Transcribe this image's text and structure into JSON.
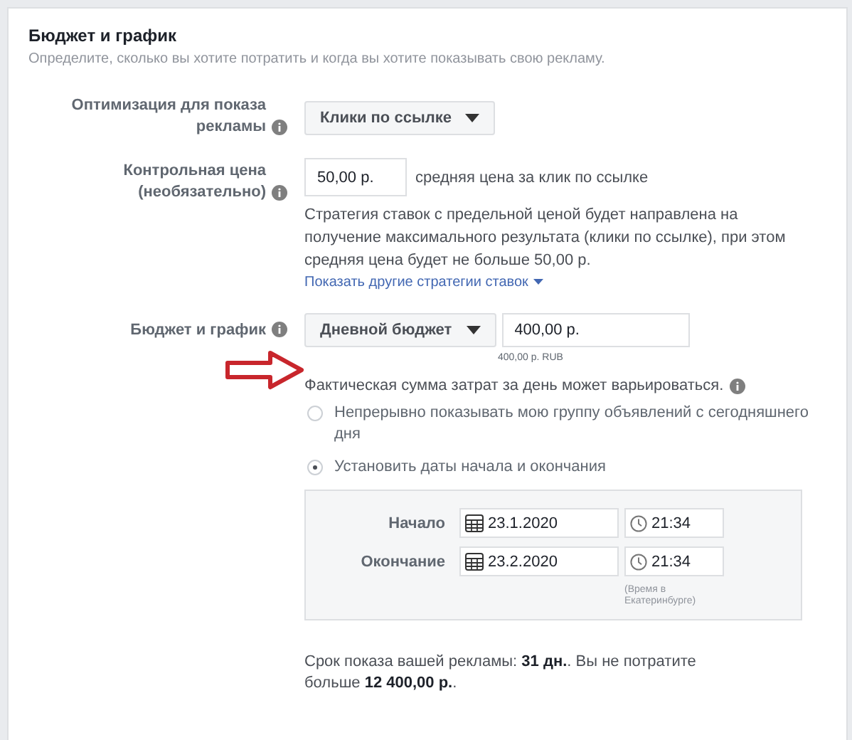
{
  "section": {
    "title": "Бюджет и график",
    "subtitle": "Определите, сколько вы хотите потратить и когда вы хотите показывать свою рекламу."
  },
  "optimization": {
    "label": "Оптимизация для показа рекламы",
    "value": "Клики по ссылке"
  },
  "bid_cap": {
    "label": "Контрольная цена (необязательно)",
    "value": "50,00 р.",
    "hint": "средняя цена за клик по ссылке",
    "description": "Стратегия ставок с предельной ценой будет направлена на получение максимального результата (клики по ссылке), при этом средняя цена будет не больше 50,00 р.",
    "link": "Показать другие стратегии ставок"
  },
  "budget": {
    "label": "Бюджет и график",
    "type": "Дневной бюджет",
    "amount": "400,00 р.",
    "currency_note": "400,00 р. RUB",
    "note": "Фактическая сумма затрат за день может варьироваться.",
    "options": [
      {
        "label": "Непрерывно показывать мою группу объявлений с сегодняшнего дня",
        "selected": false
      },
      {
        "label": "Установить даты начала и окончания",
        "selected": true
      }
    ],
    "schedule": [
      {
        "label": "Начало",
        "date": "23.1.2020",
        "time": "21:34"
      },
      {
        "label": "Окончание",
        "date": "23.2.2020",
        "time": "21:34"
      }
    ],
    "timezone_note": "(Время в Екатеринбурге)"
  },
  "summary": "Срок показа вашей рекламы: **31 дн.**. Вы не потратите больше **12 400,00 р.**."
}
